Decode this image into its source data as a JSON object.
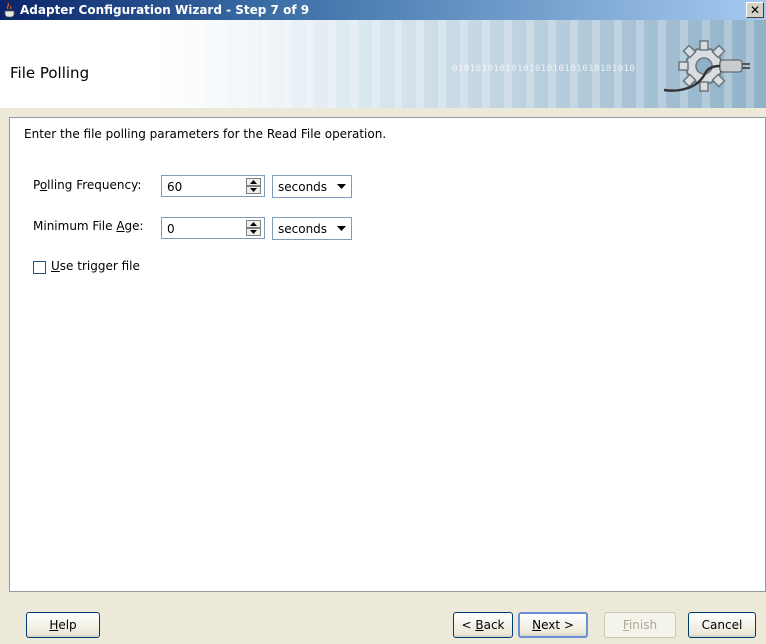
{
  "window": {
    "title": "Adapter Configuration Wizard - Step 7 of 9",
    "close_glyph": "✕"
  },
  "header": {
    "title": "File Polling",
    "decor_binary": "0101010101010101010101010101010"
  },
  "content": {
    "instruction": "Enter the file polling parameters for the Read File operation.",
    "polling_frequency": {
      "label_pre": "P",
      "label_mnemonic": "o",
      "label_post": "lling Frequency:",
      "value": "60",
      "unit": "seconds"
    },
    "minimum_file_age": {
      "label_pre": "Minimum File ",
      "label_mnemonic": "A",
      "label_post": "ge:",
      "value": "0",
      "unit": "seconds"
    },
    "use_trigger_file": {
      "label_mnemonic": "U",
      "label_post": "se trigger file",
      "checked": false
    }
  },
  "buttons": {
    "help": {
      "mnemonic": "H",
      "rest": "elp"
    },
    "back": {
      "pre": "< ",
      "mnemonic": "B",
      "rest": "ack"
    },
    "next": {
      "mnemonic": "N",
      "rest": "ext >"
    },
    "finish": {
      "mnemonic": "F",
      "rest": "inish",
      "enabled": false
    },
    "cancel": {
      "label": "Cancel"
    }
  },
  "icons": {
    "app": "java-cup-icon",
    "header": "gear-plug-icon",
    "spin": "spinner-arrows-icon",
    "dropdown": "chevron-down-icon"
  }
}
